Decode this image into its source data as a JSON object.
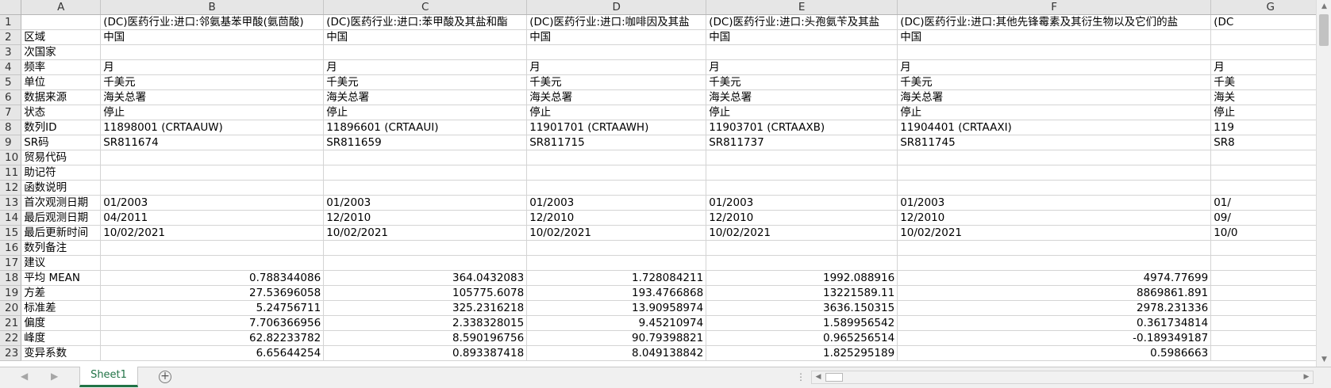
{
  "columns": [
    "A",
    "B",
    "C",
    "D",
    "E",
    "F",
    "G"
  ],
  "rows": [
    {
      "n": "1",
      "a": "",
      "b": "(DC)医药行业:进口:邻氨基苯甲酸(氨茴酸)",
      "c": "(DC)医药行业:进口:苯甲酸及其盐和酯",
      "d": "(DC)医药行业:进口:咖啡因及其盐",
      "e": "(DC)医药行业:进口:头孢氨苄及其盐",
      "f": "(DC)医药行业:进口:其他先锋霉素及其衍生物以及它们的盐",
      "g": "(DC"
    },
    {
      "n": "2",
      "a": "区域",
      "b": "中国",
      "c": "中国",
      "d": "中国",
      "e": "中国",
      "f": "中国",
      "g": ""
    },
    {
      "n": "3",
      "a": "次国家",
      "b": "",
      "c": "",
      "d": "",
      "e": "",
      "f": "",
      "g": ""
    },
    {
      "n": "4",
      "a": "频率",
      "b": "月",
      "c": "月",
      "d": "月",
      "e": "月",
      "f": "月",
      "g": "月"
    },
    {
      "n": "5",
      "a": "单位",
      "b": "千美元",
      "c": "千美元",
      "d": "千美元",
      "e": "千美元",
      "f": "千美元",
      "g": "千美"
    },
    {
      "n": "6",
      "a": "数据来源",
      "b": "海关总署",
      "c": "海关总署",
      "d": "海关总署",
      "e": "海关总署",
      "f": "海关总署",
      "g": "海关"
    },
    {
      "n": "7",
      "a": "状态",
      "b": "停止",
      "c": "停止",
      "d": "停止",
      "e": "停止",
      "f": "停止",
      "g": "停止"
    },
    {
      "n": "8",
      "a": "数列ID",
      "b": "11898001 (CRTAAUW)",
      "c": "11896601 (CRTAAUI)",
      "d": "11901701 (CRTAAWH)",
      "e": "11903701 (CRTAAXB)",
      "f": "11904401 (CRTAAXI)",
      "g": "119"
    },
    {
      "n": "9",
      "a": "SR码",
      "b": "SR811674",
      "c": "SR811659",
      "d": "SR811715",
      "e": "SR811737",
      "f": "SR811745",
      "g": "SR8"
    },
    {
      "n": "10",
      "a": "贸易代码",
      "b": "",
      "c": "",
      "d": "",
      "e": "",
      "f": "",
      "g": ""
    },
    {
      "n": "11",
      "a": "助记符",
      "b": "",
      "c": "",
      "d": "",
      "e": "",
      "f": "",
      "g": ""
    },
    {
      "n": "12",
      "a": "函数说明",
      "b": "",
      "c": "",
      "d": "",
      "e": "",
      "f": "",
      "g": ""
    },
    {
      "n": "13",
      "a": "首次观测日期",
      "b": "01/2003",
      "c": "01/2003",
      "d": "01/2003",
      "e": "01/2003",
      "f": "01/2003",
      "g": "01/"
    },
    {
      "n": "14",
      "a": "最后观测日期",
      "b": "04/2011",
      "c": "12/2010",
      "d": "12/2010",
      "e": "12/2010",
      "f": "12/2010",
      "g": "09/"
    },
    {
      "n": "15",
      "a": "最后更新时间",
      "b": "10/02/2021",
      "c": "10/02/2021",
      "d": "10/02/2021",
      "e": "10/02/2021",
      "f": "10/02/2021",
      "g": "10/0"
    },
    {
      "n": "16",
      "a": "数列备注",
      "b": "",
      "c": "",
      "d": "",
      "e": "",
      "f": "",
      "g": ""
    },
    {
      "n": "17",
      "a": "建议",
      "b": "",
      "c": "",
      "d": "",
      "e": "",
      "f": "",
      "g": ""
    },
    {
      "n": "18",
      "a": "平均 MEAN",
      "b": "0.788344086",
      "c": "364.0432083",
      "d": "1.728084211",
      "e": "1992.088916",
      "f": "4974.77699",
      "g": ""
    },
    {
      "n": "19",
      "a": "方差",
      "b": "27.53696058",
      "c": "105775.6078",
      "d": "193.4766868",
      "e": "13221589.11",
      "f": "8869861.891",
      "g": ""
    },
    {
      "n": "20",
      "a": "标准差",
      "b": "5.24756711",
      "c": "325.2316218",
      "d": "13.90958974",
      "e": "3636.150315",
      "f": "2978.231336",
      "g": ""
    },
    {
      "n": "21",
      "a": "偏度",
      "b": "7.706366956",
      "c": "2.338328015",
      "d": "9.45210974",
      "e": "1.589956542",
      "f": "0.361734814",
      "g": ""
    },
    {
      "n": "22",
      "a": "峰度",
      "b": "62.82233782",
      "c": "8.590196756",
      "d": "90.79398821",
      "e": "0.965256514",
      "f": "-0.189349187",
      "g": ""
    },
    {
      "n": "23",
      "a": "变异系数",
      "b": "6.65644254",
      "c": "0.893387418",
      "d": "8.049138842",
      "e": "1.825295189",
      "f": "0.5986663",
      "g": ""
    }
  ],
  "sheet_tabs": [
    "Sheet1"
  ],
  "colors": {
    "accent": "#217346",
    "header_bg": "#e6e6e6",
    "grid_line": "#d4d4d4"
  },
  "icons": {
    "add_sheet": "plus-circle-icon",
    "prev_sheet": "chevron-left-icon",
    "next_sheet": "chevron-right-icon"
  }
}
